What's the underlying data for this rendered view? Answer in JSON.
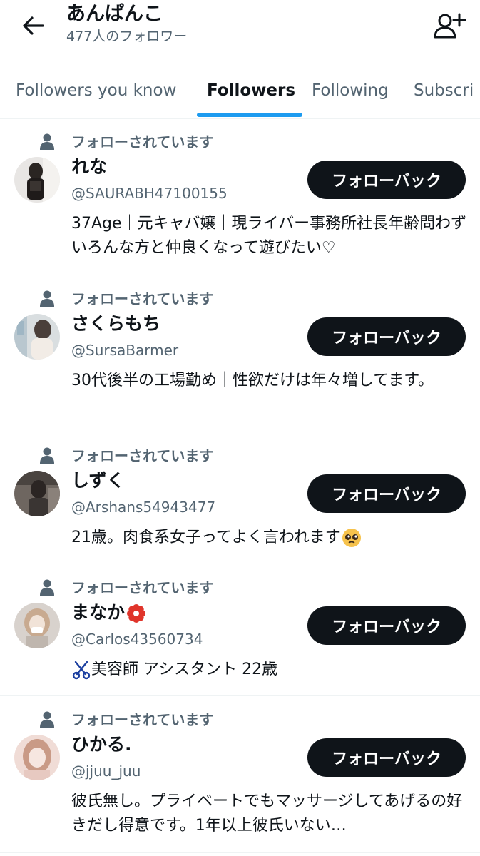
{
  "header": {
    "title": "あんぱんこ",
    "subtitle": "477人のフォロワー"
  },
  "tabs": [
    {
      "label": "Followers you know",
      "active": false
    },
    {
      "label": "Followers",
      "active": true
    },
    {
      "label": "Following",
      "active": false
    },
    {
      "label": "Subscri",
      "active": false
    }
  ],
  "colors": {
    "accent": "#1d9bf0",
    "button": "#0f1419",
    "muted": "#536471"
  },
  "users": [
    {
      "context": "フォローされています",
      "name": "れな",
      "handle": "@SAURABH47100155",
      "button": "フォローバック",
      "bio": "37Age｜元キャバ嬢｜現ライバー事務所社長年齢問わずいろんな方と仲良くなって遊びたい♡"
    },
    {
      "context": "フォローされています",
      "name": "さくらもち",
      "handle": "@SursaBarmer",
      "button": "フォローバック",
      "bio": "30代後半の工場勤め｜性欲だけは年々増してます。"
    },
    {
      "context": "フォローされています",
      "name": "しずく",
      "handle": "@Arshans54943477",
      "button": "フォローバック",
      "bio": "21歳。肉食系女子ってよく言われます",
      "bio_emoji": "pleading-face-emoji"
    },
    {
      "context": "フォローされています",
      "name": "まなか",
      "name_emoji": "red-flower-emoji",
      "handle": "@Carlos43560734",
      "button": "フォローバック",
      "bio": "美容師 アシスタント 22歳",
      "bio_emoji": "scissors-emoji"
    },
    {
      "context": "フォローされています",
      "name": "ひかる.",
      "handle": "@jjuu_juu",
      "button": "フォローバック",
      "bio": "彼氏無し。プライベートでもマッサージしてあげるの好きだし得意です。1年以上彼氏いない…"
    }
  ]
}
